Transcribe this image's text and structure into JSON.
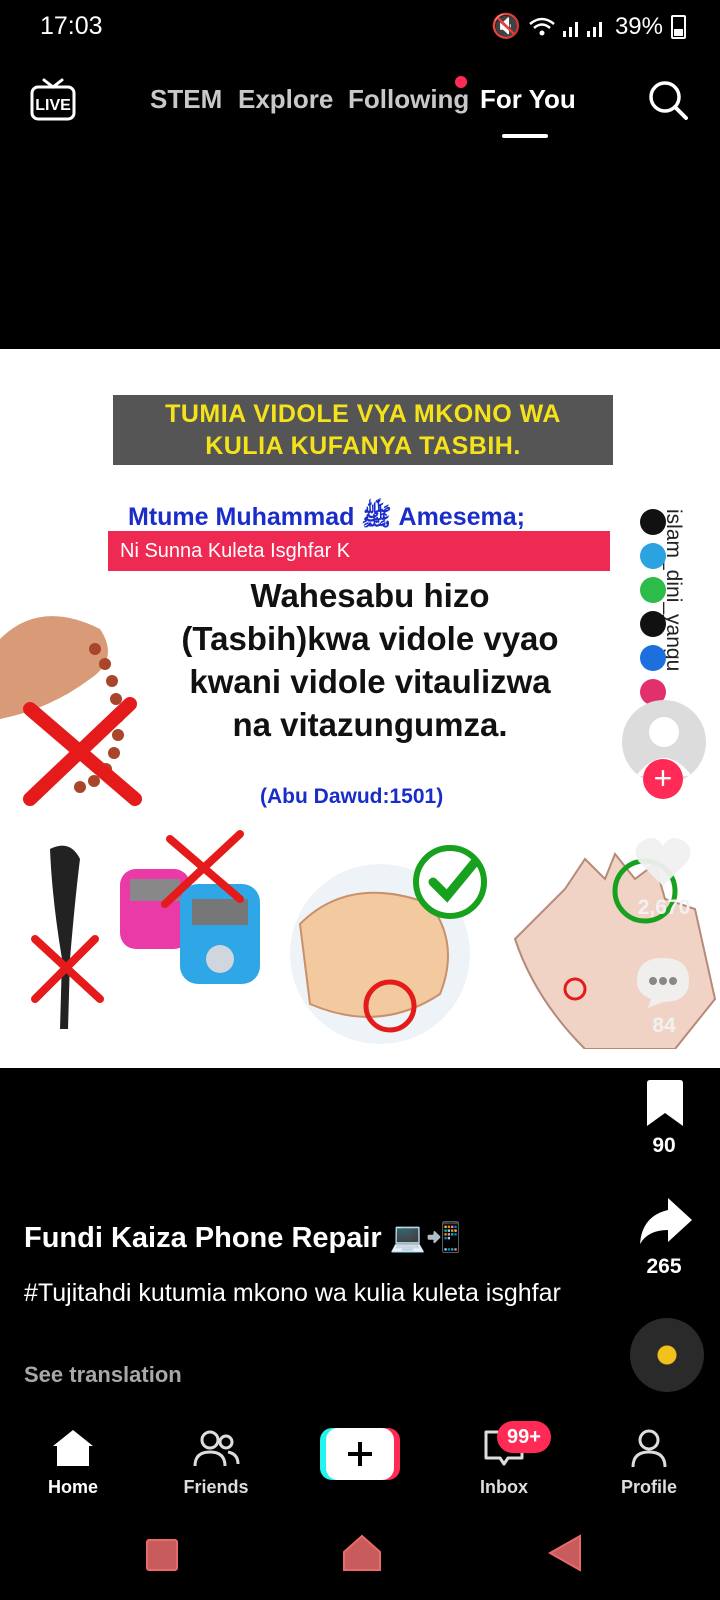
{
  "status_bar": {
    "time": "17:03",
    "battery": "39%"
  },
  "top_nav": {
    "live_label": "LIVE",
    "tabs": [
      "STEM",
      "Explore",
      "Following",
      "For You"
    ],
    "active_tab": "For You"
  },
  "video": {
    "banner_line1": "TUMIA VIDOLE VYA MKONO WA",
    "banner_line2": "KULIA KUFANYA TASBIH.",
    "prophet_line": "Mtume Muhammad ﷺ Amesema;",
    "red_strip": "Ni Sunna Kuleta Isghfar K",
    "hadith_line1": "Wahesabu hizo",
    "hadith_line2": "(Tasbih)kwa vidole vyao",
    "hadith_line3": "kwani vidole vitaulizwa",
    "hadith_line4": "na vitazungumza.",
    "reference": "(Abu Dawud:1501)",
    "handle": "islam_dini_yangu"
  },
  "right_rail": {
    "likes": "2,670",
    "comments": "84",
    "saves": "90",
    "shares": "265"
  },
  "post": {
    "author": "Fundi Kaiza Phone Repair 💻📲",
    "caption": "#Tujitahdi kutumia mkono wa kulia kuleta isghfar",
    "see_translation": "See translation"
  },
  "bottom_nav": {
    "home": "Home",
    "friends": "Friends",
    "inbox": "Inbox",
    "inbox_badge": "99+",
    "profile": "Profile"
  },
  "colors": {
    "accent": "#ff2a55",
    "banner_text": "#f4e21a",
    "blue_text": "#1a2dc9"
  }
}
